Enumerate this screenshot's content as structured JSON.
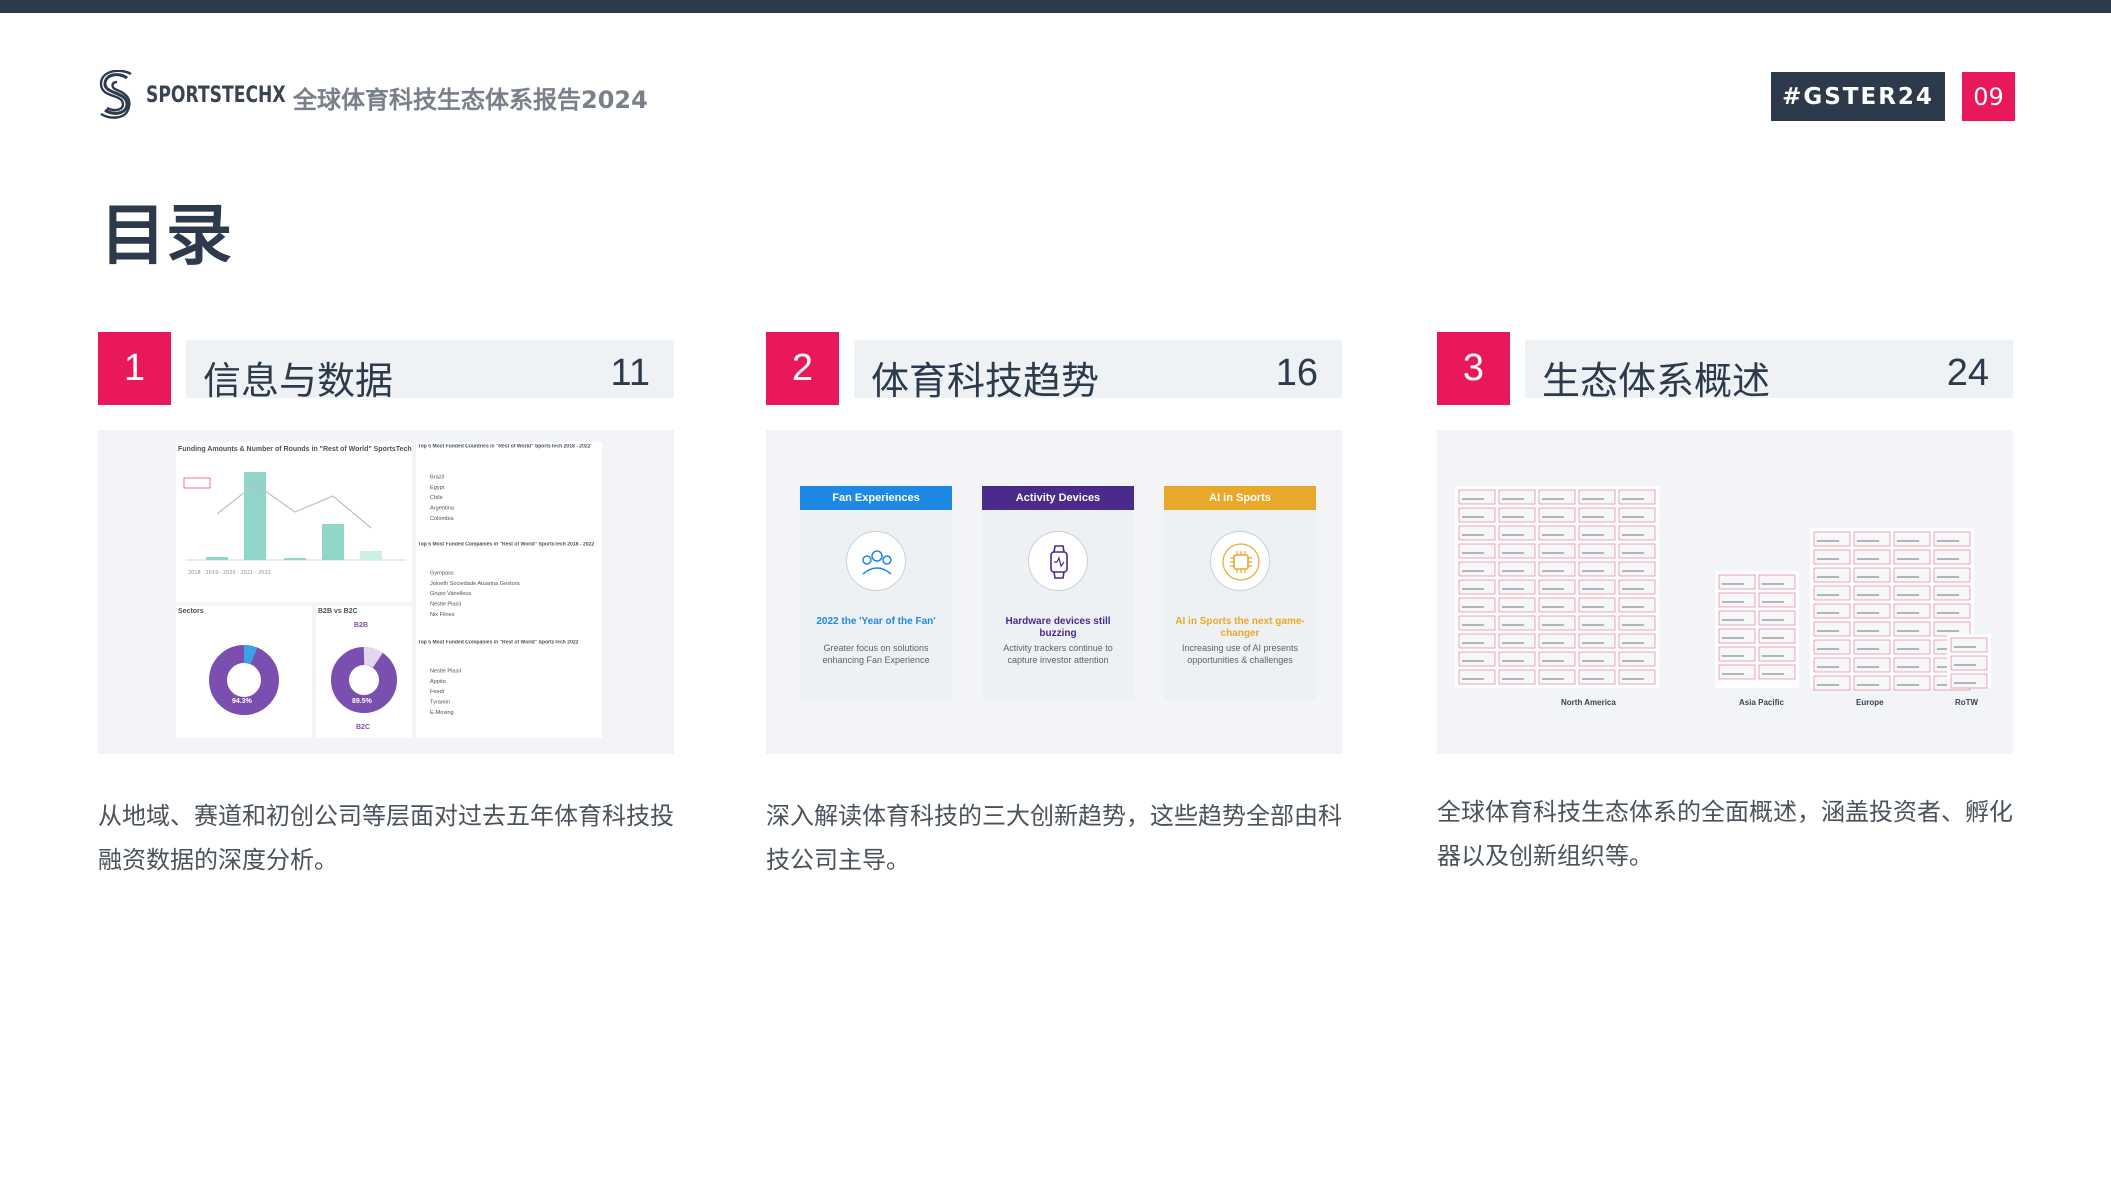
{
  "header": {
    "brand": "SPORTSTECHX",
    "report_title": "全球体育科技生态体系报告2024",
    "hashtag": "#GSTER24",
    "page_number": "09"
  },
  "heading": "目录",
  "sections": [
    {
      "number": "1",
      "title": "信息与数据",
      "page": "11",
      "description": "从地域、赛道和初创公司等层面对过去五年体育科技投融资数据的深度分析。",
      "thumbnail": {
        "chart_title": "Funding Amounts & Number of Rounds in \"Rest of World\" SportsTech",
        "table_titles": [
          "Top 5 Most Funded Countries in \"Rest of World\" SportsTech 2018 - 2022",
          "Top 5 Most Funded Companies in \"Rest of World\" SportsTech 2018 - 2022",
          "Top 5 Most Funded Companies in \"Rest of World\" SportsTech 2022"
        ],
        "countries": [
          "Brazil",
          "Egypt",
          "Chile",
          "Argentina",
          "Colombia"
        ],
        "companies_2018_2022": [
          "Gympass",
          "Joineth Sociedade Atuarina Gestora",
          "Grupo Vanelleus",
          "Nestle Plasil",
          "Nix Filnes"
        ],
        "companies_2022": [
          "Nestle Plasil",
          "Appito",
          "Feedr",
          "Tyramin",
          "E-Moving"
        ],
        "sectors_label": "Sectors",
        "b2b_label": "B2B vs B2C",
        "donut1_value": "94.3%",
        "donut2_value": "89.5%",
        "b2b_tag": "B2B",
        "b2c_tag": "B2C"
      }
    },
    {
      "number": "2",
      "title": "体育科技趋势",
      "page": "16",
      "description": "深入解读体育科技的三大创新趋势，这些趋势全部由科技公司主导。",
      "thumbnail": {
        "cards": [
          {
            "header": "Fan Experiences",
            "color": "#1e88e5",
            "title": "2022 the 'Year of the Fan'",
            "text": "Greater focus on solutions enhancing Fan Experience",
            "title_color": "#1e88e5",
            "icon": "fans-icon"
          },
          {
            "header": "Activity Devices",
            "color": "#4a2a8a",
            "title": "Hardware devices still buzzing",
            "text": "Activity trackers continue to capture investor attention",
            "title_color": "#4a2a8a",
            "icon": "smartwatch-icon"
          },
          {
            "header": "AI in Sports",
            "color": "#e8a92a",
            "title": "AI in Sports the next game-changer",
            "text": "Increasing use of AI presents opportunities & challenges",
            "title_color": "#e8a92a",
            "icon": "ai-chip-icon"
          }
        ]
      }
    },
    {
      "number": "3",
      "title": "生态体系概述",
      "page": "24",
      "description": "全球体育科技生态体系的全面概述，涵盖投资者、孵化器以及创新组织等。",
      "thumbnail": {
        "regions": [
          "North America",
          "Asia Pacific",
          "Europe",
          "RoTW"
        ]
      }
    }
  ],
  "colors": {
    "accent": "#e8185a",
    "dark": "#2c3a4c",
    "panel": "#eef2f5"
  }
}
